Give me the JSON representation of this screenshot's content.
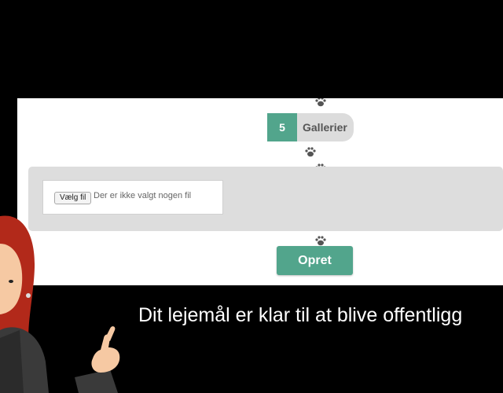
{
  "steps": {
    "gallery_count": "5",
    "gallery_label": "Gallerier"
  },
  "upload": {
    "button_label": "Vælg fil",
    "status": "Der er ikke valgt nogen fil"
  },
  "actions": {
    "create_label": "Opret"
  },
  "caption": {
    "text": "Dit lejemål er klar til at blive offentligg"
  },
  "colors": {
    "accent": "#52a58c",
    "panel": "#ffffff",
    "upload_bg": "#dddddd",
    "background": "#000000"
  },
  "icons": [
    "paw-icon",
    "presenter-illustration",
    "pointing-hand-icon"
  ]
}
